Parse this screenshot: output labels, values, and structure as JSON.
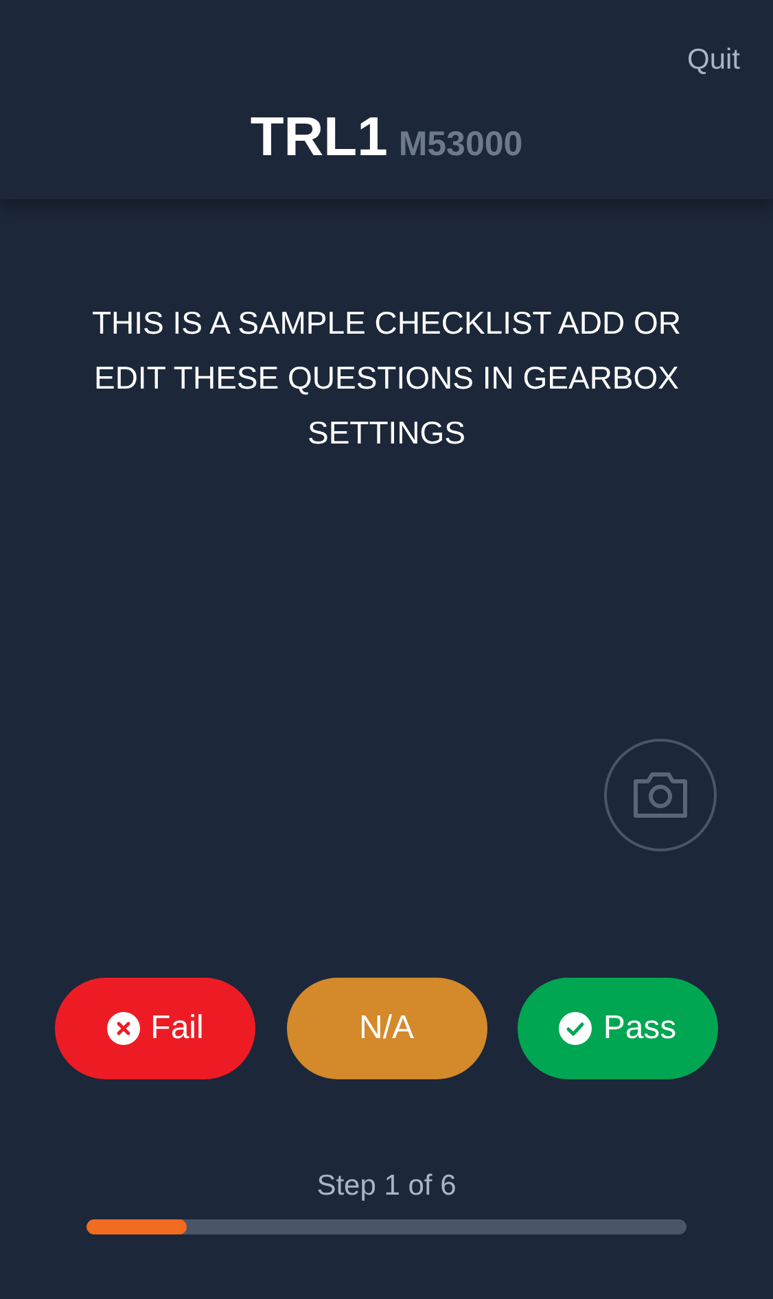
{
  "header": {
    "quit": "Quit",
    "title": "TRL1",
    "subtitle": "M53000"
  },
  "question": "THIS IS A SAMPLE CHECKLIST ADD OR EDIT THESE QUESTIONS IN GEARBOX SETTINGS",
  "answers": [
    {
      "kind": "fail",
      "label": "Fail"
    },
    {
      "kind": "na",
      "label": "N/A"
    },
    {
      "kind": "pass",
      "label": "Pass"
    }
  ],
  "progress": {
    "label": "Step 1 of 6",
    "level": 0.167
  }
}
